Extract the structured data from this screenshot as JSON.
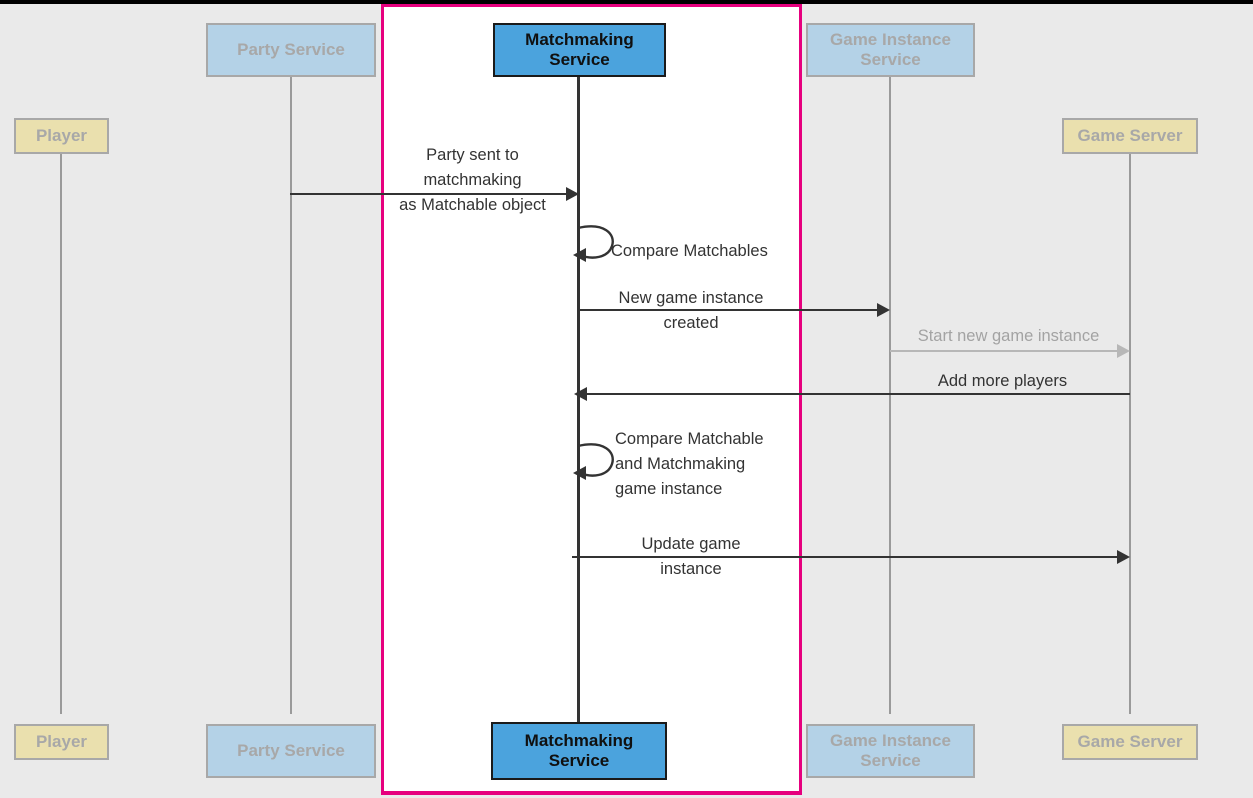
{
  "diagram": {
    "type": "sequence-diagram",
    "title": "Matchmaking Service sequence",
    "highlight": {
      "name": "matchmaking-service-highlight",
      "color": "#e6007e"
    },
    "colors": {
      "background": "#eaeaea",
      "highlight_background": "#ffffff",
      "highlight_border": "#e6007e",
      "participant_blue": "#b4d2e7",
      "participant_yellow": "#eae0ae",
      "participant_active": "#4ba3dd",
      "muted_text": "#a8a8a8",
      "active_text": "#101010",
      "message_text": "#333333",
      "faded_message": "#b7b7b7",
      "lifeline": "#9a9a9a",
      "topbar": "#000000"
    }
  },
  "participants": [
    {
      "id": "player",
      "label": "Player",
      "style": "yellow",
      "state": "muted"
    },
    {
      "id": "party-service",
      "label": "Party Service",
      "style": "blue",
      "state": "muted"
    },
    {
      "id": "matchmaking-service",
      "label": "Matchmaking\nService",
      "style": "active",
      "state": "highlighted"
    },
    {
      "id": "game-instance-service",
      "label": "Game Instance\nService",
      "style": "blue",
      "state": "muted"
    },
    {
      "id": "game-server",
      "label": "Game Server",
      "style": "yellow",
      "state": "muted"
    }
  ],
  "participants_top": {
    "player": "Player",
    "party_service": "Party Service",
    "matchmaking_service": "Matchmaking Service",
    "matchmaking_service_line1": "Matchmaking",
    "matchmaking_service_line2": "Service",
    "game_instance_service_line1": "Game Instance",
    "game_instance_service_line2": "Service",
    "game_server": "Game Server"
  },
  "participants_bottom": {
    "player": "Player",
    "party_service": "Party Service",
    "matchmaking_service_line1": "Matchmaking",
    "matchmaking_service_line2": "Service",
    "game_instance_service_line1": "Game Instance",
    "game_instance_service_line2": "Service",
    "game_server": "Game Server"
  },
  "messages": [
    {
      "id": "party-sent-to-matchmaking",
      "label": "Party sent to\nmatchmaking\nas Matchable object",
      "from": "party-service",
      "to": "matchmaking-service",
      "direction": "right",
      "style": "solid",
      "faded": false
    },
    {
      "id": "compare-matchables",
      "label": "Compare Matchables",
      "from": "matchmaking-service",
      "to": "matchmaking-service",
      "direction": "self",
      "style": "solid",
      "faded": false
    },
    {
      "id": "new-game-instance-created",
      "label": "New game instance\ncreated",
      "from": "matchmaking-service",
      "to": "game-instance-service",
      "direction": "right",
      "style": "solid",
      "faded": false
    },
    {
      "id": "start-new-game-instance",
      "label": "Start new game instance",
      "from": "game-instance-service",
      "to": "game-server",
      "direction": "right",
      "style": "solid",
      "faded": true
    },
    {
      "id": "add-more-players",
      "label": "Add more players",
      "from": "game-server",
      "to": "matchmaking-service",
      "direction": "left",
      "style": "solid",
      "faded": false
    },
    {
      "id": "compare-matchable-and-matchmaking-game-instance",
      "label": "Compare Matchable\nand Matchmaking\ngame instance",
      "from": "matchmaking-service",
      "to": "matchmaking-service",
      "direction": "self",
      "style": "solid",
      "faded": false
    },
    {
      "id": "update-game-instance",
      "label": "Update game\ninstance",
      "from": "matchmaking-service",
      "to": "game-server",
      "direction": "right",
      "style": "solid",
      "faded": false
    }
  ],
  "message_labels": {
    "party_sent": "Party sent to\nmatchmaking\nas Matchable object",
    "compare_matchables": "Compare Matchables",
    "new_game_instance": "New game instance\ncreated",
    "start_new_game_instance": "Start new game instance",
    "add_more_players": "Add more players",
    "compare_matchable_and_mm": "Compare Matchable\nand Matchmaking\ngame instance",
    "update_game_instance": "Update game\ninstance"
  }
}
